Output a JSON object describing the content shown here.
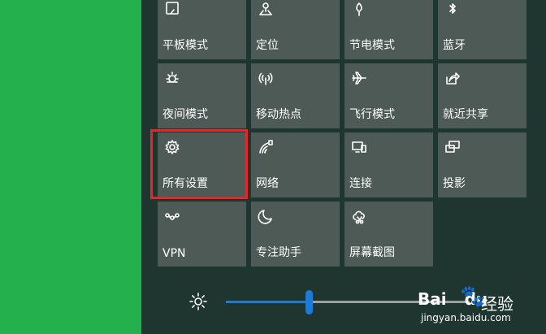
{
  "tiles": [
    {
      "label": "平板模式",
      "icon": "tablet-mode-icon"
    },
    {
      "label": "定位",
      "icon": "location-icon"
    },
    {
      "label": "节电模式",
      "icon": "battery-saver-icon"
    },
    {
      "label": "蓝牙",
      "icon": "bluetooth-icon"
    },
    {
      "label": "夜间模式",
      "icon": "night-light-icon"
    },
    {
      "label": "移动热点",
      "icon": "mobile-hotspot-icon"
    },
    {
      "label": "飞行模式",
      "icon": "airplane-icon"
    },
    {
      "label": "就近共享",
      "icon": "nearby-sharing-icon"
    },
    {
      "label": "所有设置",
      "icon": "gear-icon"
    },
    {
      "label": "网络",
      "icon": "network-icon"
    },
    {
      "label": "连接",
      "icon": "connect-icon"
    },
    {
      "label": "投影",
      "icon": "project-icon"
    },
    {
      "label": "VPN",
      "icon": "vpn-icon"
    },
    {
      "label": "专注助手",
      "icon": "moon-icon"
    },
    {
      "label": "屏幕截图",
      "icon": "screen-snip-icon"
    }
  ],
  "brightness": {
    "level": 0.34
  },
  "watermark": {
    "brand": "Bai",
    "brand_suffix": "du",
    "zh": "经验",
    "url": "jingyan.baidu.com"
  },
  "colors": {
    "desktop": "#23b04d",
    "panel": "#1f3530",
    "tile": "#4d5a55",
    "highlight": "#e5272b",
    "accent": "#1f7ad6"
  }
}
